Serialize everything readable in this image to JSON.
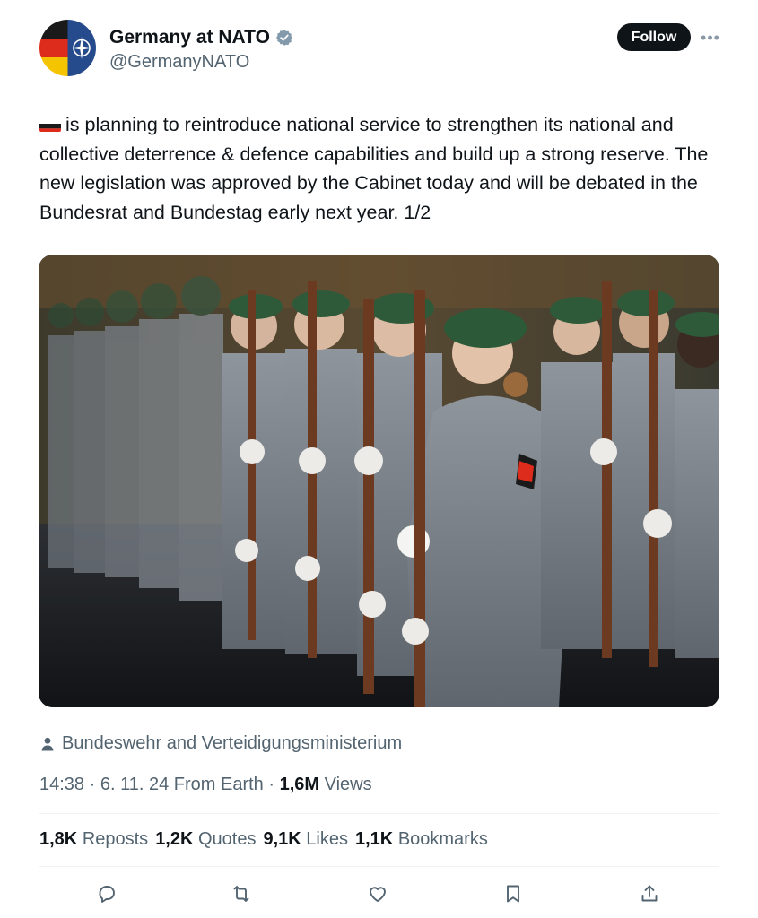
{
  "author": {
    "name": "Germany at NATO",
    "handle": "@GermanyNATO",
    "verified_icon": "verified-badge-icon"
  },
  "follow_label": "Follow",
  "more_icon": "more-options-icon",
  "tweet": {
    "flag_emoji": "🇩🇪",
    "text": "is planning to reintroduce national service to strengthen its national and collective deterrence & defence capabilities and build up a strong reserve. The new legislation was approved by the Cabinet today and will be debated in the Bundesrat and Bundestag early next year. 1/2"
  },
  "media": {
    "type": "photo"
  },
  "tagged": "Bundeswehr and Verteidigungsministerium",
  "meta": {
    "time": "14:38",
    "date": "6. 11. 24",
    "source": "From Earth",
    "views_count": "1,6M",
    "views_label": "Views"
  },
  "stats": [
    {
      "count": "1,8K",
      "label": "Reposts"
    },
    {
      "count": "1,2K",
      "label": "Quotes"
    },
    {
      "count": "9,1K",
      "label": "Likes"
    },
    {
      "count": "1,1K",
      "label": "Bookmarks"
    }
  ],
  "actions": [
    "reply-icon",
    "repost-icon",
    "like-icon",
    "bookmark-icon",
    "share-icon"
  ],
  "colors": {
    "text": "#0f1419",
    "secondary": "#536471",
    "divider": "#eff3f4",
    "verified": "#829aab"
  }
}
